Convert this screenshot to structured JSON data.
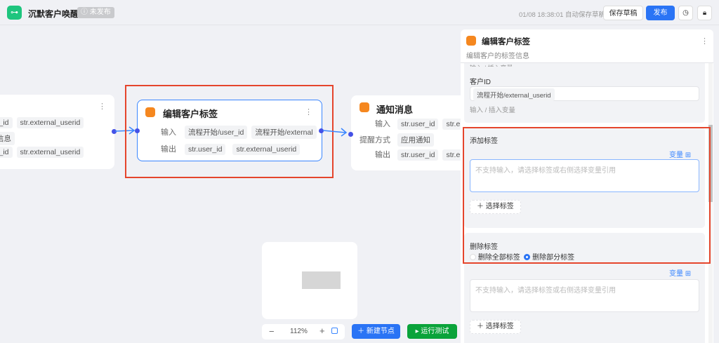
{
  "header": {
    "title": "沉默客户唤醒",
    "status_badge": "未发布",
    "saved_text": "01/08 18:38:01 自动保存草稿",
    "save_draft": "保存草稿",
    "publish": "发布",
    "history_icon": "clock-icon",
    "lock_icon": "lock-icon"
  },
  "nodes": {
    "left": {
      "row1": [
        "r_id",
        "str.external_userid"
      ],
      "row2": "信息",
      "row3": [
        "r_id",
        "str.external_userid"
      ]
    },
    "edit": {
      "title": "编辑客户标签",
      "input_label": "输入",
      "inputs": [
        "流程开始/user_id",
        "流程开始/external"
      ],
      "output_label": "输出",
      "outputs": [
        "str.user_id",
        "str.external_userid"
      ]
    },
    "notify": {
      "title": "通知消息",
      "input_label": "输入",
      "inputs": [
        "str.user_id",
        "str.e"
      ],
      "remind_label": "提醒方式",
      "remind": "应用通知",
      "output_label": "输出",
      "outputs": [
        "str.user_id",
        "str.e"
      ]
    }
  },
  "minimap": {
    "zoom": "112%"
  },
  "toolbar": {
    "new_node": "新建节点",
    "run_test": "运行测试"
  },
  "panel": {
    "title": "编辑客户标签",
    "desc": "编辑客户的标签信息",
    "cut_hint": "输入 / 插入变量",
    "customer_id_label": "客户ID",
    "customer_id_value": "流程开始/external_userid",
    "customer_id_hint": "输入 / 插入变量",
    "add_tag": {
      "label": "添加标签",
      "var": "变量",
      "placeholder": "不支持输入，请选择标签或右侧选择变量引用",
      "select": "选择标签"
    },
    "remove_tag": {
      "label": "删除标签",
      "options": [
        "删除全部标签",
        "删除部分标签"
      ],
      "selected": 1,
      "var": "变量",
      "placeholder": "不支持输入，请选择标签或右侧选择变量引用",
      "select": "选择标签"
    }
  },
  "colors": {
    "accent": "#2a74f5",
    "highlight": "#e5452c",
    "node_icon": "#f5871f",
    "run": "#0aa33a",
    "logo": "#1ec57e"
  }
}
